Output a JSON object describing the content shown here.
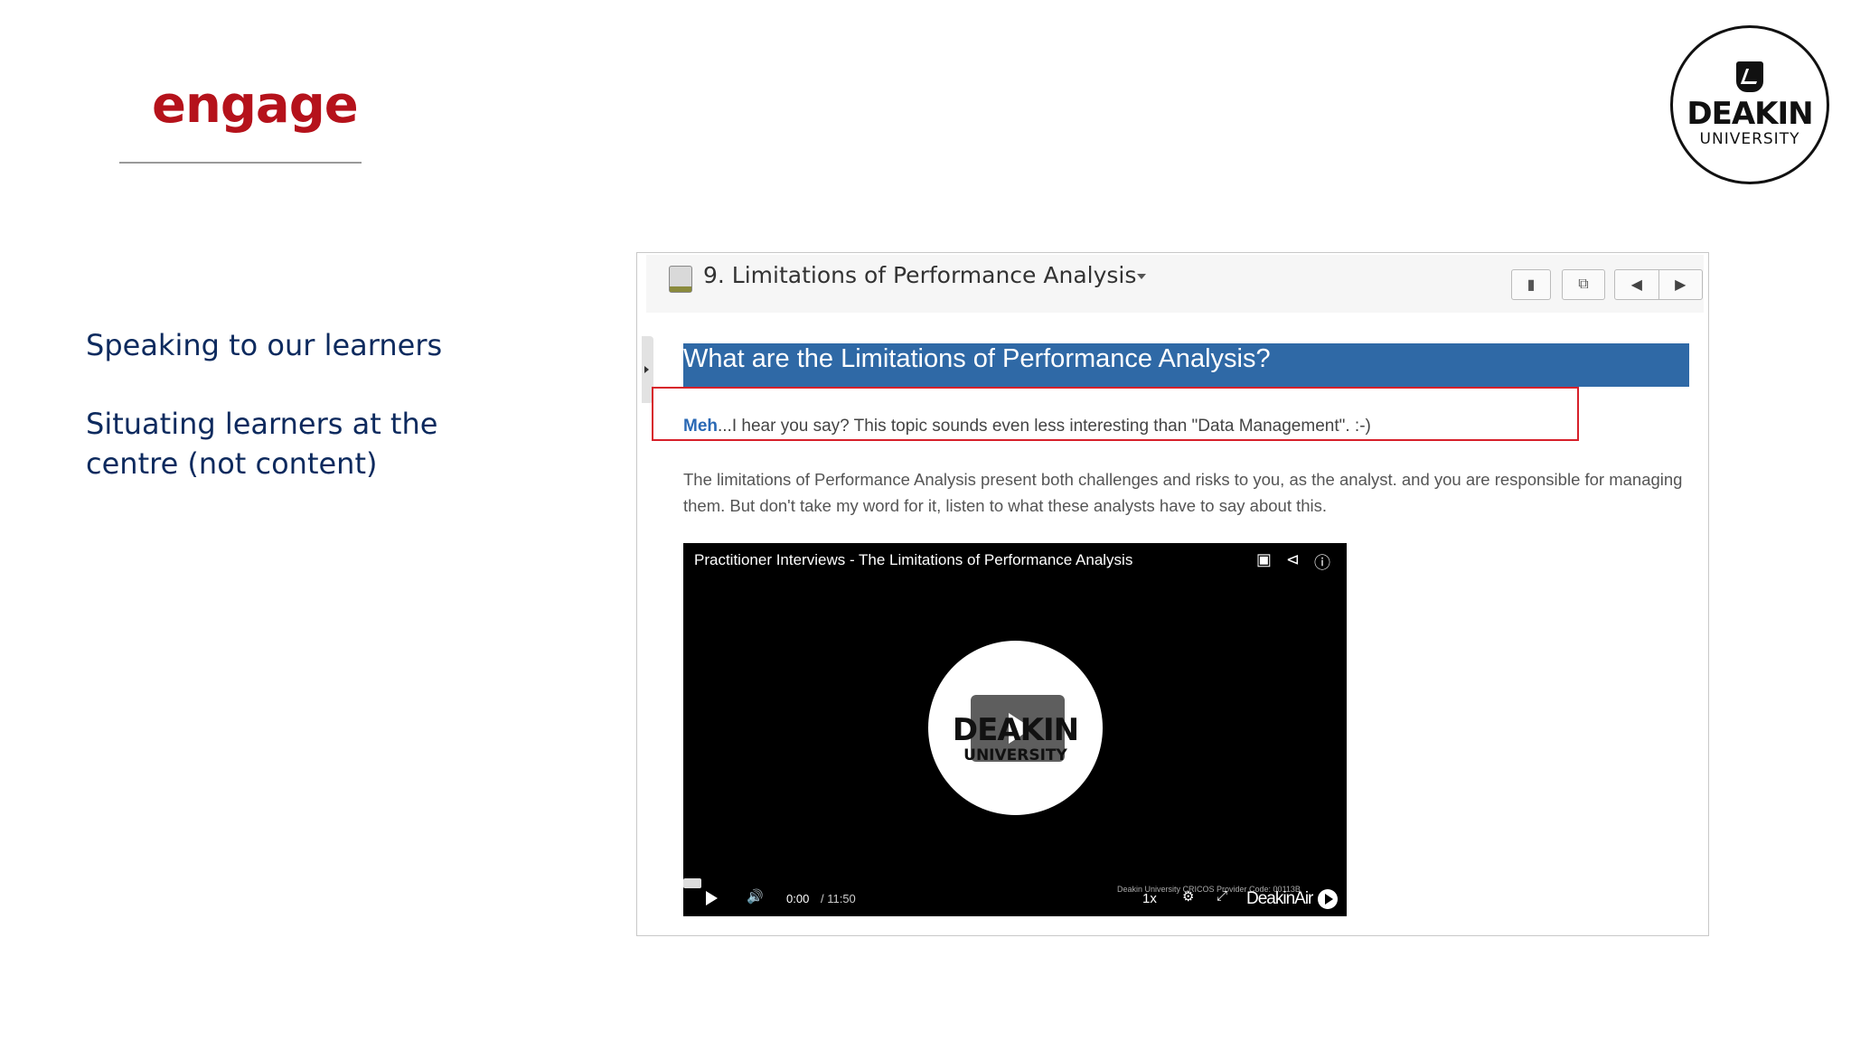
{
  "slide": {
    "title": "engage",
    "points": [
      "Speaking to our learners",
      "Situating learners at the",
      "centre (not content)"
    ]
  },
  "logo": {
    "name": "DEAKIN",
    "sub": "UNIVERSITY"
  },
  "course_page": {
    "breadcrumb": "9. Limitations of Performance Analysis",
    "heading": "What are the Limitations of Performance Analysis?",
    "meh_bold": "Meh",
    "meh_rest": "...I hear you say? This topic sounds even less interesting than \"Data Management\". :-)",
    "paragraph": "The limitations of Performance Analysis present both challenges and risks to you, as the analyst. and you are responsible for managing them. But don't take my word for it, listen to what these analysts have to say about this."
  },
  "video": {
    "title": "Practitioner Interviews - The Limitations of Performance Analysis",
    "time_current": "0:00",
    "time_total": "/ 11:50",
    "speed": "1x",
    "credit": "Deakin University CRICOS Provider Code: 00113B",
    "brand": "DeakinAir",
    "center_logo": "DEAKIN",
    "center_logo_sub": "UNIVERSITY"
  },
  "colors": {
    "title_red": "#b5121b",
    "text_navy": "#0d2a5e",
    "heading_blue": "#2f69a6",
    "highlight_red": "#d7202a"
  }
}
